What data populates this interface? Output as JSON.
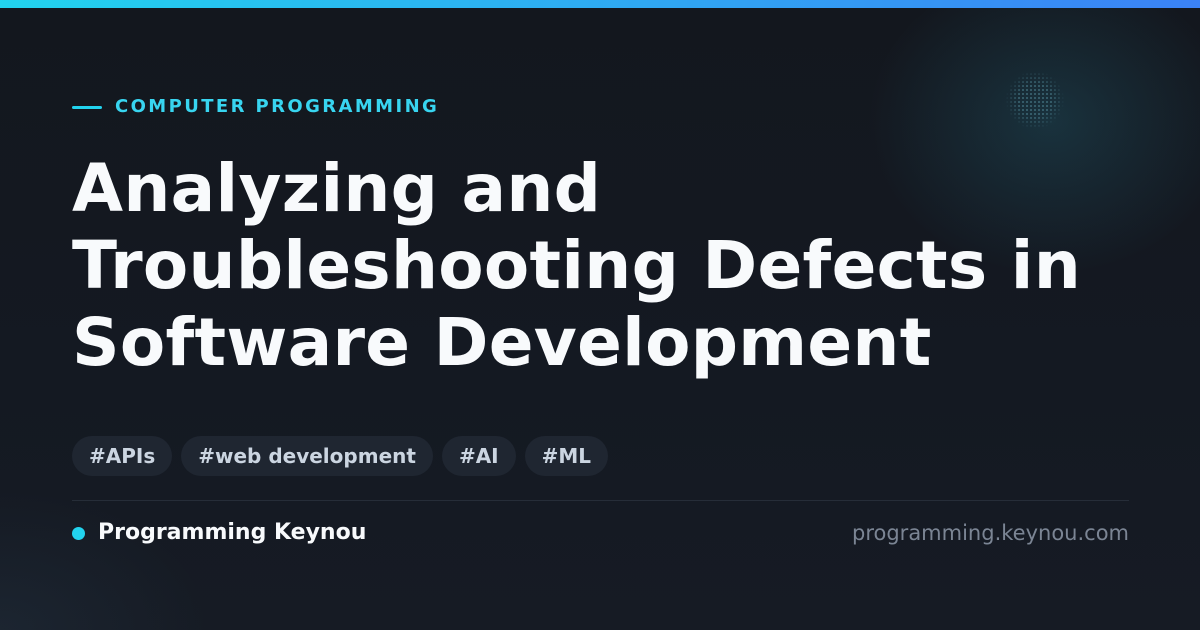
{
  "card": {
    "category": "COMPUTER PROGRAMMING",
    "title": "Analyzing and Troubleshooting Defects in Software Development",
    "tags": [
      "#APIs",
      "#web development",
      "#AI",
      "#ML"
    ],
    "brand": "Programming Keynou",
    "url": "programming.keynou.com"
  },
  "colors": {
    "accent": "#22d3ee",
    "accent_gradient_end": "#3b82f6",
    "background": "#13171e",
    "title_text": "#f8fafc",
    "tag_background": "#1f2631",
    "tag_text": "#cbd5e1",
    "url_text": "#7b8594"
  },
  "icons": {
    "category_marker": "dash-line-icon",
    "brand_marker": "dot-icon"
  }
}
